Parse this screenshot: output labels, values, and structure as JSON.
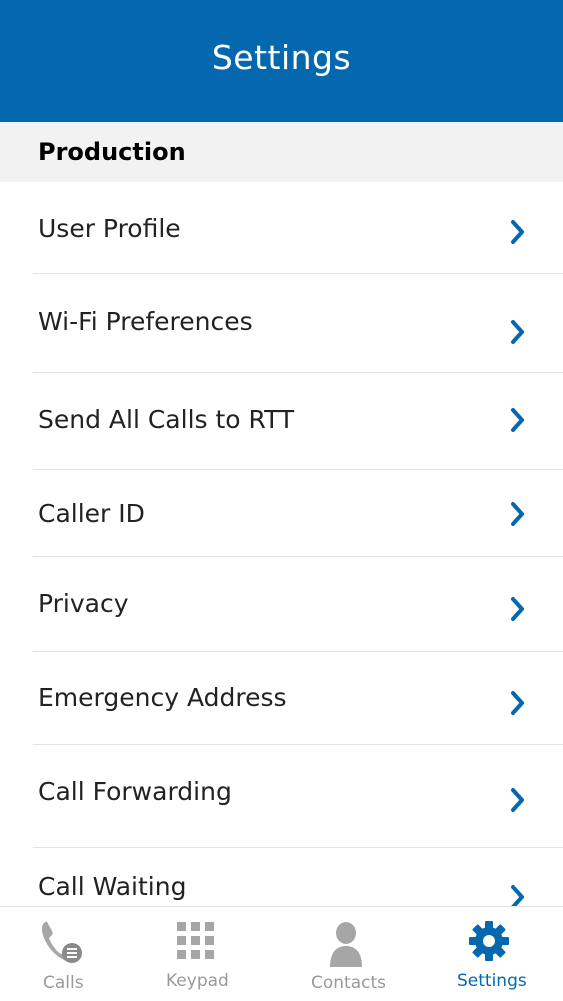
{
  "header": {
    "title": "Settings"
  },
  "section": {
    "title": "Production"
  },
  "items": [
    {
      "label": "User Profile"
    },
    {
      "label": "Wi-Fi Preferences"
    },
    {
      "label": "Send All Calls to RTT"
    },
    {
      "label": "Caller ID"
    },
    {
      "label": "Privacy"
    },
    {
      "label": "Emergency Address"
    },
    {
      "label": "Call Forwarding"
    },
    {
      "label": "Call Waiting"
    }
  ],
  "tabs": [
    {
      "label": "Calls",
      "icon": "phone-icon"
    },
    {
      "label": "Keypad",
      "icon": "keypad-icon"
    },
    {
      "label": "Contacts",
      "icon": "person-icon"
    },
    {
      "label": "Settings",
      "icon": "gear-icon",
      "active": true
    }
  ],
  "colors": {
    "brand": "#0568ae",
    "chevron": "#0568ae",
    "inactive_tab": "#9a9a9a"
  }
}
